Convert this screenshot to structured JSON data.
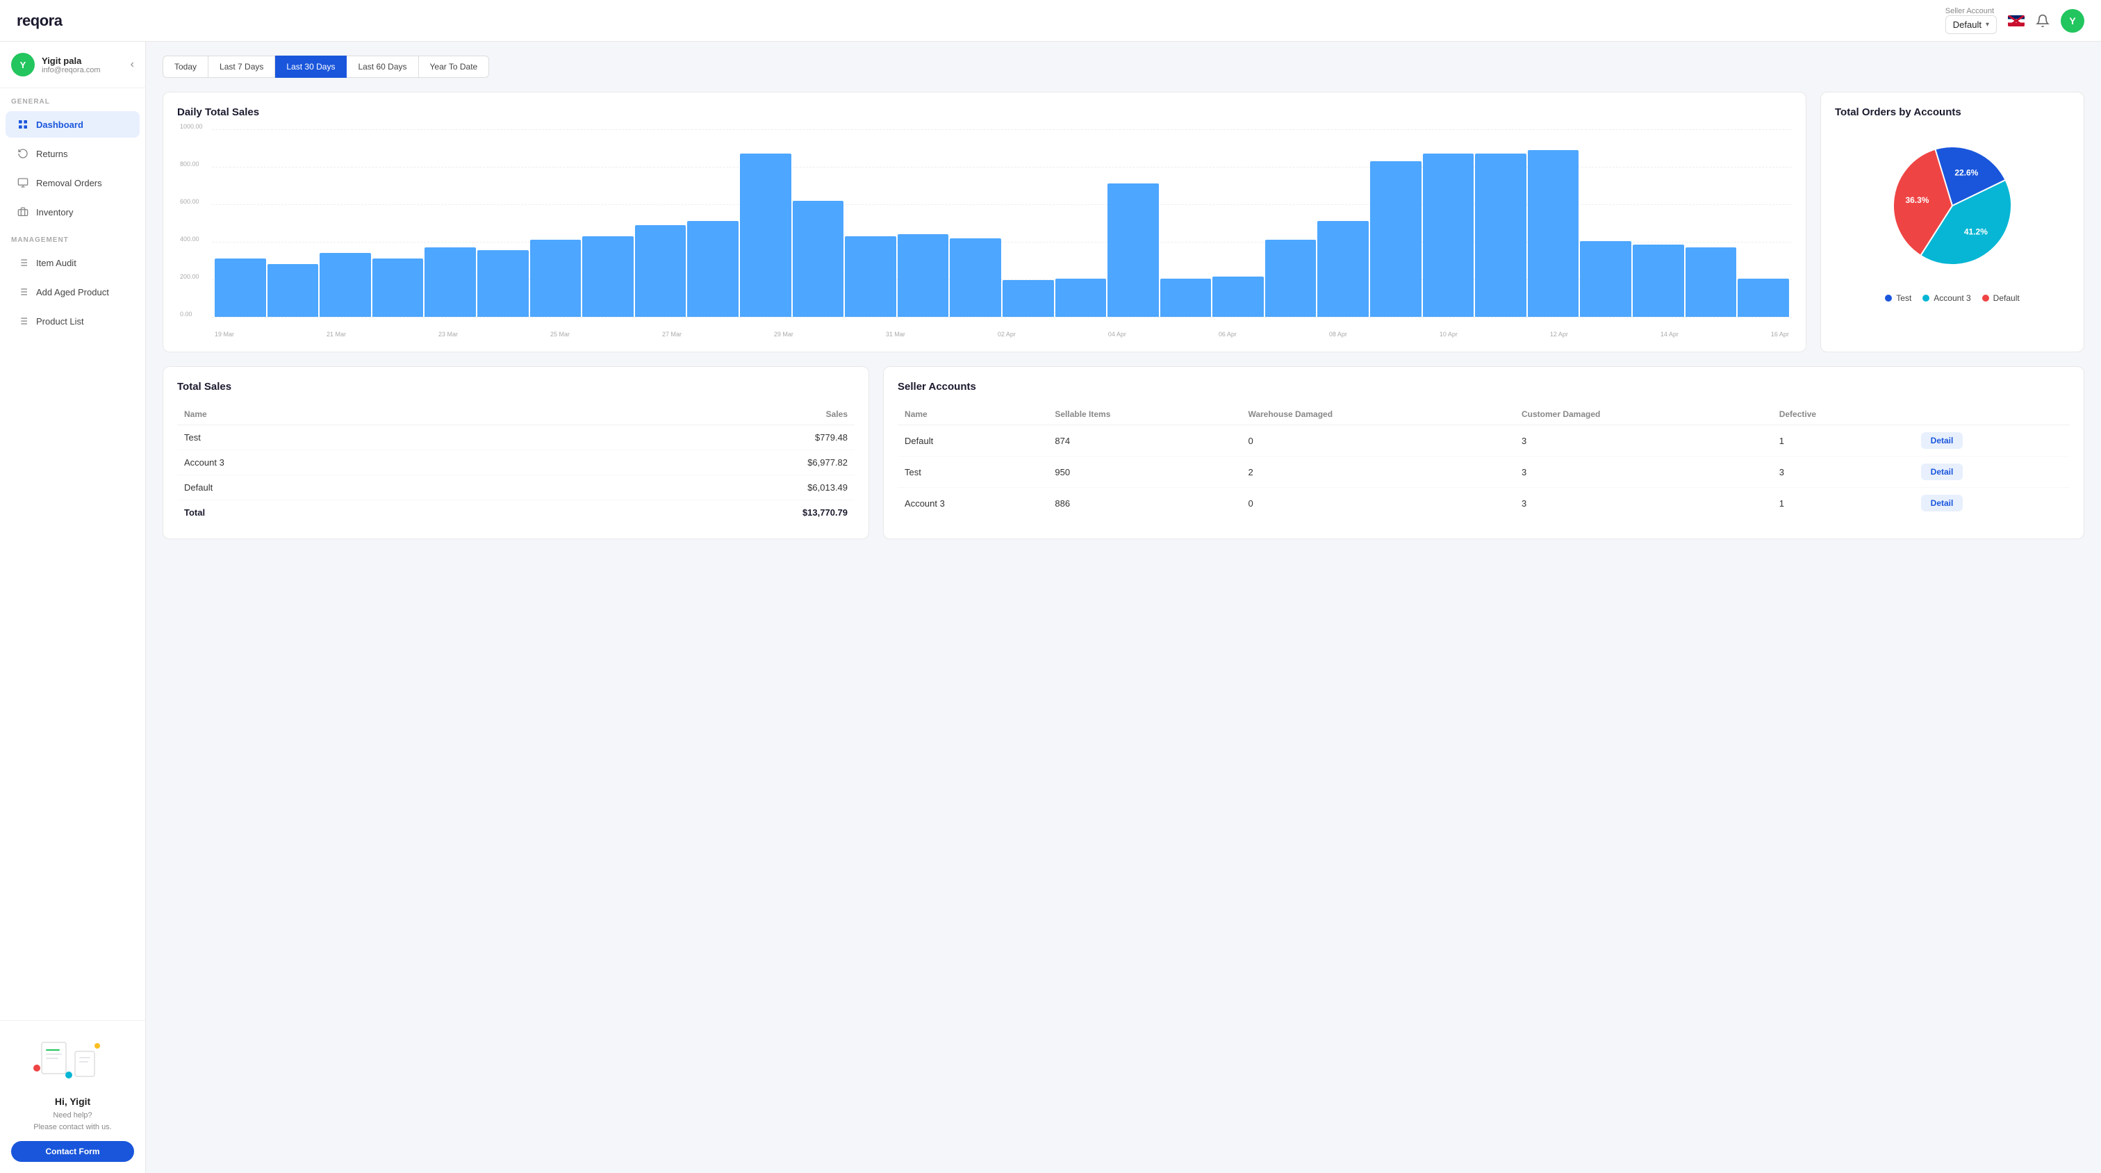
{
  "app": {
    "logo": "reqora"
  },
  "topbar": {
    "seller_account_label": "Seller Account",
    "seller_account_value": "Default",
    "avatar_initial": "Y"
  },
  "sidebar": {
    "user": {
      "name": "Yigit pala",
      "email": "info@reqora.com",
      "avatar_initial": "Y"
    },
    "general_label": "GENERAL",
    "management_label": "MANAGEMENT",
    "items_general": [
      {
        "id": "dashboard",
        "label": "Dashboard",
        "active": true
      },
      {
        "id": "returns",
        "label": "Returns",
        "active": false
      },
      {
        "id": "removal-orders",
        "label": "Removal Orders",
        "active": false
      },
      {
        "id": "inventory",
        "label": "Inventory",
        "active": false
      }
    ],
    "items_management": [
      {
        "id": "item-audit",
        "label": "Item Audit",
        "active": false
      },
      {
        "id": "add-aged-product",
        "label": "Add Aged Product",
        "active": false
      },
      {
        "id": "product-list",
        "label": "Product List",
        "active": false
      }
    ],
    "bottom": {
      "greeting": "Hi, Yigit",
      "help_line1": "Need help?",
      "help_line2": "Please contact with us.",
      "contact_btn": "Contact Form"
    }
  },
  "filter_tabs": [
    {
      "label": "Today",
      "active": false
    },
    {
      "label": "Last 7 Days",
      "active": false
    },
    {
      "label": "Last 30 Days",
      "active": true
    },
    {
      "label": "Last 60 Days",
      "active": false
    },
    {
      "label": "Year To Date",
      "active": false
    }
  ],
  "daily_sales_chart": {
    "title": "Daily Total Sales",
    "y_labels": [
      "1000.00",
      "800.00",
      "600.00",
      "400.00",
      "200.00",
      "0.00"
    ],
    "x_labels": [
      "19 Mar",
      "21 Mar",
      "23 Mar",
      "25 Mar",
      "27 Mar",
      "29 Mar",
      "31 Mar",
      "02 Apr",
      "04 Apr",
      "06 Apr",
      "08 Apr",
      "10 Apr",
      "12 Apr",
      "14 Apr",
      "16 Apr"
    ],
    "bars": [
      {
        "label": "19 Mar",
        "value": 310
      },
      {
        "label": "",
        "value": 280
      },
      {
        "label": "21 Mar",
        "value": 340
      },
      {
        "label": "",
        "value": 310
      },
      {
        "label": "23 Mar",
        "value": 370
      },
      {
        "label": "",
        "value": 355
      },
      {
        "label": "25 Mar",
        "value": 410
      },
      {
        "label": "",
        "value": 430
      },
      {
        "label": "27 Mar",
        "value": 490
      },
      {
        "label": "",
        "value": 510
      },
      {
        "label": "29 Mar",
        "value": 870
      },
      {
        "label": "",
        "value": 620
      },
      {
        "label": "31 Mar",
        "value": 430
      },
      {
        "label": "",
        "value": 440
      },
      {
        "label": "02 Apr",
        "value": 420
      },
      {
        "label": "",
        "value": 195
      },
      {
        "label": "04 Apr",
        "value": 205
      },
      {
        "label": "",
        "value": 710
      },
      {
        "label": "06 Apr",
        "value": 205
      },
      {
        "label": "",
        "value": 215
      },
      {
        "label": "08 Apr",
        "value": 410
      },
      {
        "label": "",
        "value": 510
      },
      {
        "label": "10 Apr",
        "value": 830
      },
      {
        "label": "",
        "value": 870
      },
      {
        "label": "12 Apr",
        "value": 870
      },
      {
        "label": "",
        "value": 890
      },
      {
        "label": "14 Apr",
        "value": 405
      },
      {
        "label": "",
        "value": 385
      },
      {
        "label": "16 Apr",
        "value": 370
      },
      {
        "label": "",
        "value": 205
      }
    ]
  },
  "pie_chart": {
    "title": "Total Orders by Accounts",
    "slices": [
      {
        "label": "Test",
        "percent": 22.6,
        "color": "#1a56db"
      },
      {
        "label": "Account 3",
        "percent": 41.2,
        "color": "#06b6d4"
      },
      {
        "label": "Default",
        "percent": 36.3,
        "color": "#ef4444"
      }
    ]
  },
  "total_sales_table": {
    "title": "Total Sales",
    "columns": [
      "Name",
      "Sales"
    ],
    "rows": [
      {
        "name": "Test",
        "sales": "$779.48"
      },
      {
        "name": "Account 3",
        "sales": "$6,977.82"
      },
      {
        "name": "Default",
        "sales": "$6,013.49"
      },
      {
        "name": "Total",
        "sales": "$13,770.79",
        "is_total": true
      }
    ]
  },
  "seller_accounts_table": {
    "title": "Seller Accounts",
    "columns": [
      "Name",
      "Sellable Items",
      "Warehouse Damaged",
      "Customer Damaged",
      "Defective",
      ""
    ],
    "rows": [
      {
        "name": "Default",
        "sellable": "874",
        "warehouse_damaged": "0",
        "customer_damaged": "3",
        "defective": "1"
      },
      {
        "name": "Test",
        "sellable": "950",
        "warehouse_damaged": "2",
        "customer_damaged": "3",
        "defective": "3"
      },
      {
        "name": "Account 3",
        "sellable": "886",
        "warehouse_damaged": "0",
        "customer_damaged": "3",
        "defective": "1"
      }
    ],
    "detail_btn": "Detail"
  }
}
